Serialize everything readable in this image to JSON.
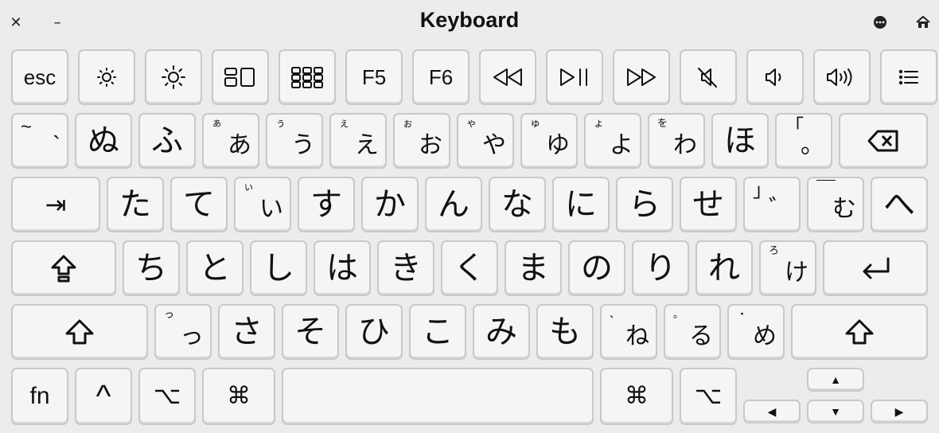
{
  "window": {
    "title": "Keyboard",
    "icons": {
      "close": "close-icon",
      "minimize": "minimize-icon",
      "more": "more-icon",
      "home": "home-icon"
    },
    "close_glyph": "✕",
    "minimize_glyph": "–"
  },
  "keys": {
    "fn_row": [
      {
        "name": "esc-key",
        "label": "esc"
      },
      {
        "name": "brightness-down-key",
        "icon": "brightness-down-icon"
      },
      {
        "name": "brightness-up-key",
        "icon": "brightness-up-icon"
      },
      {
        "name": "mission-control-key",
        "icon": "mission-control-icon"
      },
      {
        "name": "launchpad-key",
        "icon": "launchpad-icon"
      },
      {
        "name": "f5-key",
        "label": "F5"
      },
      {
        "name": "f6-key",
        "label": "F6"
      },
      {
        "name": "rewind-key",
        "icon": "rewind-icon"
      },
      {
        "name": "play-pause-key",
        "icon": "play-pause-icon"
      },
      {
        "name": "fast-forward-key",
        "icon": "fast-forward-icon"
      },
      {
        "name": "mute-key",
        "icon": "mute-icon"
      },
      {
        "name": "volume-down-key",
        "icon": "volume-down-icon"
      },
      {
        "name": "volume-up-key",
        "icon": "volume-up-icon"
      },
      {
        "name": "list-key",
        "icon": "list-icon"
      }
    ],
    "row1": [
      {
        "main": "`",
        "shift": "~"
      },
      {
        "main": "ぬ"
      },
      {
        "main": "ふ"
      },
      {
        "main": "あ",
        "shift": "ぁ"
      },
      {
        "main": "う",
        "shift": "ぅ"
      },
      {
        "main": "え",
        "shift": "ぇ"
      },
      {
        "main": "お",
        "shift": "ぉ"
      },
      {
        "main": "や",
        "shift": "ゃ"
      },
      {
        "main": "ゆ",
        "shift": "ゅ"
      },
      {
        "main": "よ",
        "shift": "ょ"
      },
      {
        "main": "わ",
        "shift": "を"
      },
      {
        "main": "ほ"
      },
      {
        "main": "。",
        "shift": "「"
      }
    ],
    "row2": [
      {
        "main": "た"
      },
      {
        "main": "て"
      },
      {
        "main": "い",
        "shift": "ぃ"
      },
      {
        "main": "す"
      },
      {
        "main": "か"
      },
      {
        "main": "ん"
      },
      {
        "main": "な"
      },
      {
        "main": "に"
      },
      {
        "main": "ら"
      },
      {
        "main": "せ"
      },
      {
        "main": "゛",
        "shift": "」"
      },
      {
        "main": "む",
        "shift": "￣"
      },
      {
        "main": "へ"
      }
    ],
    "row3": [
      {
        "main": "ち"
      },
      {
        "main": "と"
      },
      {
        "main": "し"
      },
      {
        "main": "は"
      },
      {
        "main": "き"
      },
      {
        "main": "く"
      },
      {
        "main": "ま"
      },
      {
        "main": "の"
      },
      {
        "main": "り"
      },
      {
        "main": "れ"
      },
      {
        "main": "け",
        "shift": "ろ"
      }
    ],
    "row4": [
      {
        "main": "っ",
        "shift": "っ"
      },
      {
        "main": "さ"
      },
      {
        "main": "そ"
      },
      {
        "main": "ひ"
      },
      {
        "main": "こ"
      },
      {
        "main": "み"
      },
      {
        "main": "も"
      },
      {
        "main": "ね",
        "shift": "、"
      },
      {
        "main": "る",
        "shift": "。"
      },
      {
        "main": "め",
        "shift": "・"
      }
    ],
    "bottom": {
      "fn": "fn",
      "control": "^",
      "option": "⌥",
      "command": "⌘",
      "arrow_up": "▲",
      "arrow_left": "◀",
      "arrow_down": "▼",
      "arrow_right": "▶"
    },
    "special": {
      "tab": "⇥",
      "backspace_icon": "delete-left-icon",
      "caps_icon": "caps-lock-icon",
      "return_icon": "return-icon",
      "shift_icon": "shift-icon"
    }
  }
}
